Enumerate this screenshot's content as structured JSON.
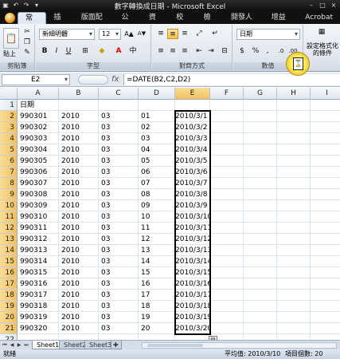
{
  "window": {
    "title": "數字轉換成日期 - Microsoft Excel"
  },
  "ribbon_tabs": [
    "常用",
    "插入",
    "版面配置",
    "公式",
    "資料",
    "校閱",
    "檢視",
    "開發人員",
    "增益集",
    "Acrobat"
  ],
  "ribbon": {
    "paste_label": "貼上",
    "font_name": "新細明體",
    "font_size": "12",
    "number_format": "日期",
    "cond_format_label": "設定格式化的條件",
    "groups": {
      "clipboard": "剪貼簿",
      "font": "字型",
      "alignment": "對齊方式",
      "number": "數值"
    },
    "bold": "B",
    "italic": "I",
    "underline": "U",
    "percent": "%",
    "comma": ",",
    "currency": "$"
  },
  "formula_bar": {
    "name_box": "E2",
    "fx": "fx",
    "formula": "=DATE(B2,C2,D2)"
  },
  "columns": [
    "A",
    "B",
    "C",
    "D",
    "E",
    "F",
    "G",
    "H",
    "I"
  ],
  "header_row": {
    "A": "日期"
  },
  "rows": [
    {
      "num": "1",
      "A": "日期",
      "B": "",
      "C": "",
      "D": "",
      "E": ""
    },
    {
      "num": "2",
      "A": "990301",
      "B": "2010",
      "C": "03",
      "D": "01",
      "E": "2010/3/1"
    },
    {
      "num": "3",
      "A": "990302",
      "B": "2010",
      "C": "03",
      "D": "02",
      "E": "2010/3/2"
    },
    {
      "num": "4",
      "A": "990303",
      "B": "2010",
      "C": "03",
      "D": "03",
      "E": "2010/3/3"
    },
    {
      "num": "5",
      "A": "990304",
      "B": "2010",
      "C": "03",
      "D": "04",
      "E": "2010/3/4"
    },
    {
      "num": "6",
      "A": "990305",
      "B": "2010",
      "C": "03",
      "D": "05",
      "E": "2010/3/5"
    },
    {
      "num": "7",
      "A": "990306",
      "B": "2010",
      "C": "03",
      "D": "06",
      "E": "2010/3/6"
    },
    {
      "num": "8",
      "A": "990307",
      "B": "2010",
      "C": "03",
      "D": "07",
      "E": "2010/3/7"
    },
    {
      "num": "9",
      "A": "990308",
      "B": "2010",
      "C": "03",
      "D": "08",
      "E": "2010/3/8"
    },
    {
      "num": "10",
      "A": "990309",
      "B": "2010",
      "C": "03",
      "D": "09",
      "E": "2010/3/9"
    },
    {
      "num": "11",
      "A": "990310",
      "B": "2010",
      "C": "03",
      "D": "10",
      "E": "2010/3/10"
    },
    {
      "num": "12",
      "A": "990311",
      "B": "2010",
      "C": "03",
      "D": "11",
      "E": "2010/3/11"
    },
    {
      "num": "13",
      "A": "990312",
      "B": "2010",
      "C": "03",
      "D": "12",
      "E": "2010/3/12"
    },
    {
      "num": "14",
      "A": "990313",
      "B": "2010",
      "C": "03",
      "D": "13",
      "E": "2010/3/13"
    },
    {
      "num": "15",
      "A": "990314",
      "B": "2010",
      "C": "03",
      "D": "14",
      "E": "2010/3/14"
    },
    {
      "num": "16",
      "A": "990315",
      "B": "2010",
      "C": "03",
      "D": "15",
      "E": "2010/3/15"
    },
    {
      "num": "17",
      "A": "990316",
      "B": "2010",
      "C": "03",
      "D": "16",
      "E": "2010/3/16"
    },
    {
      "num": "18",
      "A": "990317",
      "B": "2010",
      "C": "03",
      "D": "17",
      "E": "2010/3/17"
    },
    {
      "num": "19",
      "A": "990318",
      "B": "2010",
      "C": "03",
      "D": "18",
      "E": "2010/3/18"
    },
    {
      "num": "20",
      "A": "990319",
      "B": "2010",
      "C": "03",
      "D": "19",
      "E": "2010/3/19"
    },
    {
      "num": "21",
      "A": "990320",
      "B": "2010",
      "C": "03",
      "D": "20",
      "E": "2010/3/20"
    },
    {
      "num": "22",
      "A": "",
      "B": "",
      "C": "",
      "D": "",
      "E": ""
    }
  ],
  "sheets": [
    "Sheet1",
    "Sheet2",
    "Sheet3"
  ],
  "status": {
    "ready": "就緒",
    "average": "平均值: 2010/3/10",
    "count": "項目個數: 20"
  },
  "colors": {
    "selection_header": "#f1c15e",
    "ribbon_bg": "#e2e7ee",
    "title_bg": "#0f0f0f"
  }
}
